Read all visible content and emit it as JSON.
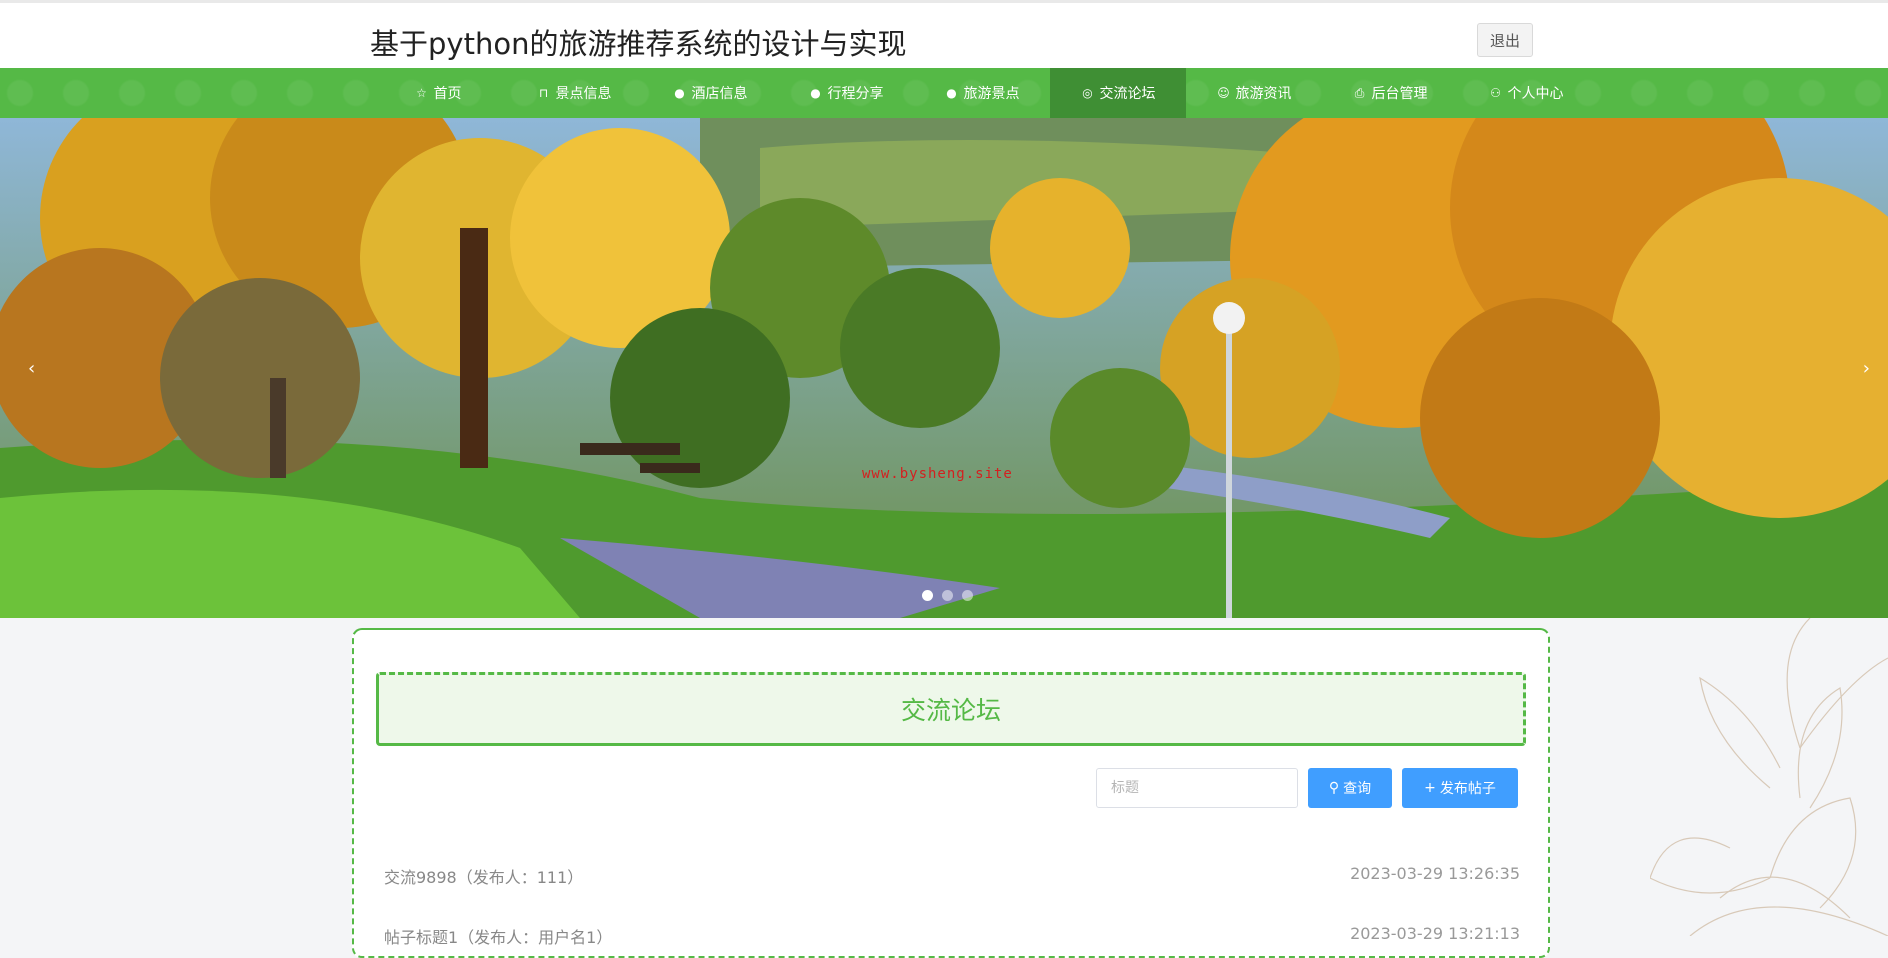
{
  "header": {
    "title": "基于python的旅游推荐系统的设计与实现",
    "logout_label": "退出"
  },
  "nav": {
    "items": [
      {
        "label": "首页",
        "icon": "star-icon",
        "glyph": "☆",
        "active": false
      },
      {
        "label": "景点信息",
        "icon": "bag-icon",
        "glyph": "⊓",
        "active": false
      },
      {
        "label": "酒店信息",
        "icon": "info-icon",
        "glyph": "●",
        "active": false
      },
      {
        "label": "行程分享",
        "icon": "question-icon",
        "glyph": "●",
        "active": false
      },
      {
        "label": "旅游景点",
        "icon": "info-icon",
        "glyph": "●",
        "active": false
      },
      {
        "label": "交流论坛",
        "icon": "help-ring-icon",
        "glyph": "◎",
        "active": true
      },
      {
        "label": "旅游资讯",
        "icon": "smile-icon",
        "glyph": "☺",
        "active": false
      },
      {
        "label": "后台管理",
        "icon": "clipboard-icon",
        "glyph": "⎙",
        "active": false
      },
      {
        "label": "个人中心",
        "icon": "user-icon",
        "glyph": "⚇",
        "active": false
      }
    ]
  },
  "carousel": {
    "prev_glyph": "‹",
    "next_glyph": "›",
    "slide_count": 3,
    "active_slide": 1,
    "watermark": "www.bysheng.site"
  },
  "forum": {
    "title": "交流论坛",
    "search_placeholder": "标题",
    "query_label": "查询",
    "post_label": "发布帖子",
    "query_icon": "search-icon",
    "post_icon": "plus-icon",
    "posts": [
      {
        "title": "交流9898（发布人：111）",
        "time": "2023-03-29 13:26:35"
      },
      {
        "title": "帖子标题1（发布人：用户名1）",
        "time": "2023-03-29 13:21:13"
      }
    ]
  },
  "colors": {
    "brand": "#55b946",
    "nav_active": "#3f8f34",
    "button": "#409eff"
  }
}
